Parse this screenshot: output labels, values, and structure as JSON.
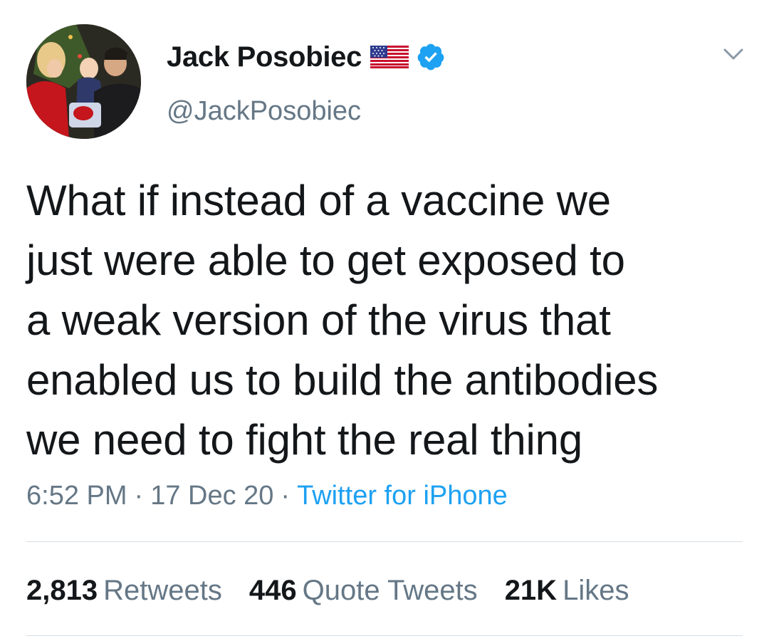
{
  "author": {
    "name": "Jack Posobiec",
    "handle": "@JackPosobiec",
    "flag_icon": "us-flag-icon",
    "verified_icon": "verified-badge-icon"
  },
  "tweet": {
    "text": "What if instead of a vaccine we\njust were able to get exposed to\na weak version of the virus that\nenabled us to build the antibodies\nwe need to fight the real thing"
  },
  "meta": {
    "time": "6:52 PM",
    "date": "17 Dec 20",
    "separator": "·",
    "source": "Twitter for iPhone"
  },
  "stats": {
    "retweets_count": "2,813",
    "retweets_label": "Retweets",
    "quotes_count": "446",
    "quotes_label": "Quote Tweets",
    "likes_count": "21K",
    "likes_label": "Likes"
  },
  "colors": {
    "link": "#1da1f2",
    "secondary_text": "#657786",
    "primary_text": "#14171a",
    "verified": "#1da1f2"
  },
  "icons": {
    "menu": "chevron-down-icon"
  }
}
